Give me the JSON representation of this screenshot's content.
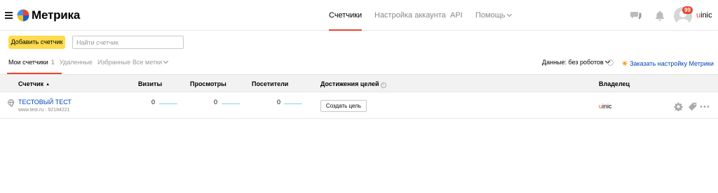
{
  "header": {
    "title": "Метрика",
    "nav": [
      {
        "label": "Счетчики",
        "active": true
      },
      {
        "label": "Настройка аккаунта",
        "active": false
      },
      {
        "label": "API",
        "active": false
      },
      {
        "label": "Помощь",
        "active": false
      }
    ],
    "notifications_badge": "99",
    "username_first": "u",
    "username_rest": "inic"
  },
  "toolbar": {
    "add_counter_label": "Добавить счетчик",
    "search_placeholder": "Найти счетчик",
    "search_value": ""
  },
  "filters": {
    "my_counters_label": "Мои счетчики",
    "my_counters_count": "1",
    "deleted_label": "Удаленные",
    "favorites_label": "Избранные",
    "all_tags_label": "Все метки",
    "data_filter_label": "Данные: без роботов",
    "order_setup_label": "Заказать настройку Метрики"
  },
  "table": {
    "columns": {
      "counter": "Счетчик",
      "visits": "Визиты",
      "views": "Просмотры",
      "visitors": "Посетители",
      "goals": "Достижения целей",
      "owner": "Владелец"
    },
    "rows": [
      {
        "name": "ТЕСТОВЫЙ ТЕСТ",
        "site": "www.test.ru · 92184221",
        "visits": "0",
        "views": "0",
        "visitors": "0",
        "create_goal_label": "Создать цель",
        "owner_first": "u",
        "owner_rest": "inic"
      }
    ]
  },
  "colors": {
    "accent": "#e8452c",
    "button_yellow": "#ffdb4d",
    "link_blue": "#0044bb",
    "sparkline": "#7fd8d4"
  }
}
